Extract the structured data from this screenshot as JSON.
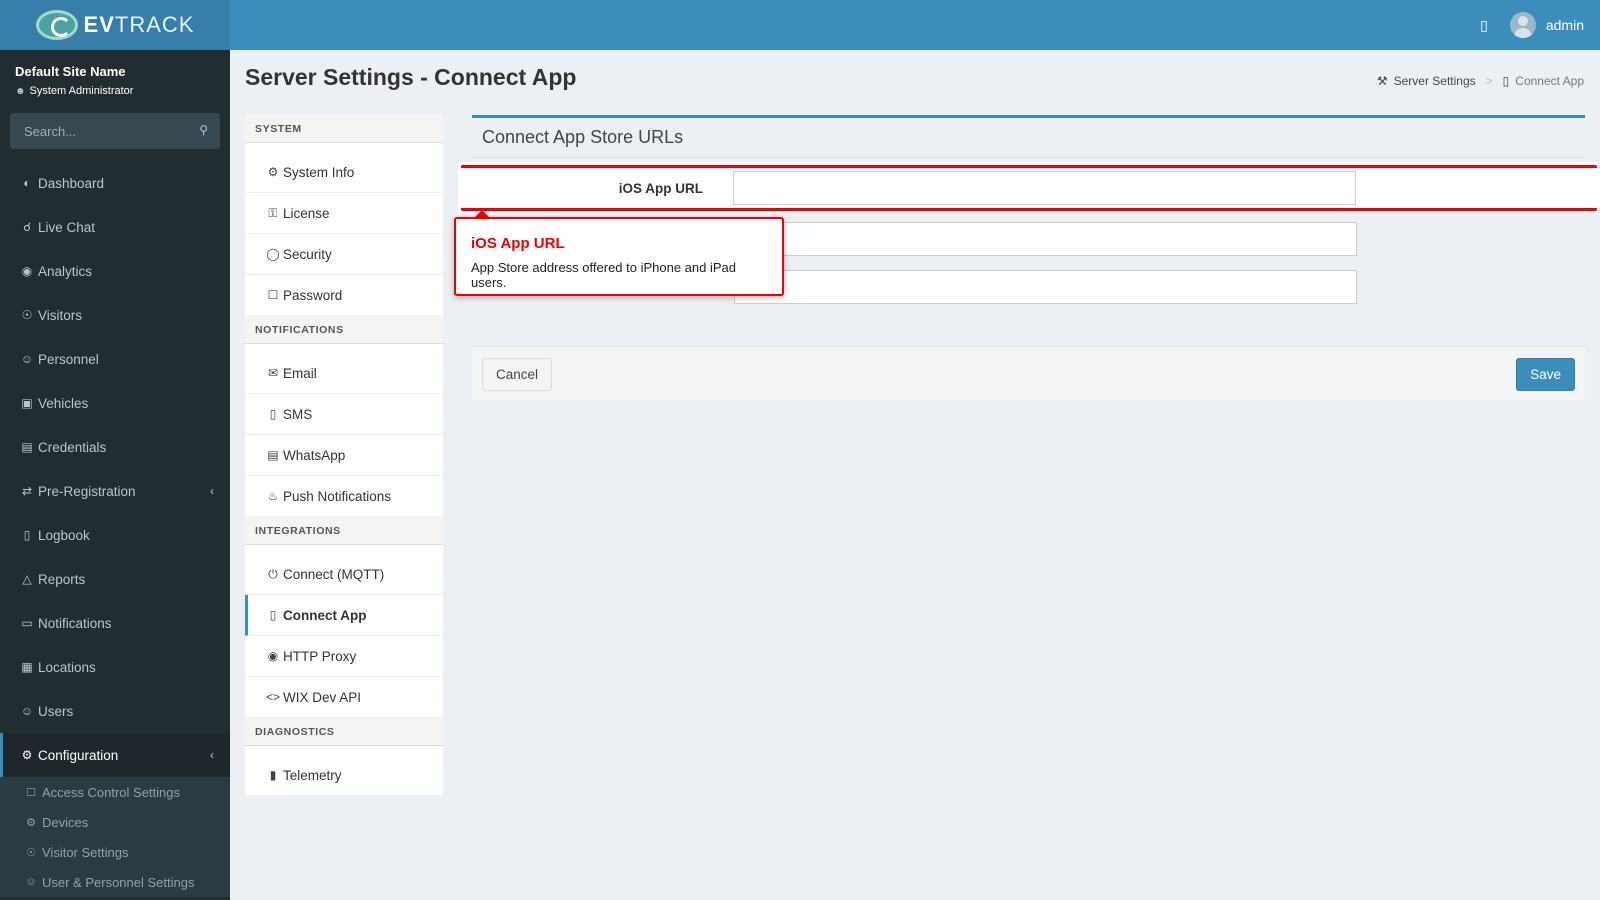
{
  "header": {
    "brand_prefix": "EV",
    "brand_suffix": "TRACK",
    "user_name": "admin",
    "building_icon": "building-icon"
  },
  "sidebar": {
    "site_name": "Default Site Name",
    "role": "System Administrator",
    "search_placeholder": "Search...",
    "items": [
      {
        "label": "Dashboard",
        "icon": "dashboard-icon"
      },
      {
        "label": "Live Chat",
        "icon": "headset-icon"
      },
      {
        "label": "Analytics",
        "icon": "analytics-icon"
      },
      {
        "label": "Visitors",
        "icon": "eye-icon"
      },
      {
        "label": "Personnel",
        "icon": "personnel-icon"
      },
      {
        "label": "Vehicles",
        "icon": "car-icon"
      },
      {
        "label": "Credentials",
        "icon": "credential-icon"
      },
      {
        "label": "Pre-Registration",
        "icon": "arrows-icon"
      },
      {
        "label": "Logbook",
        "icon": "book-icon"
      },
      {
        "label": "Reports",
        "icon": "chart-icon"
      },
      {
        "label": "Notifications",
        "icon": "notification-icon"
      },
      {
        "label": "Locations",
        "icon": "map-icon"
      },
      {
        "label": "Users",
        "icon": "users-icon"
      },
      {
        "label": "Configuration",
        "icon": "gear-icon"
      }
    ],
    "sub_items": [
      {
        "label": "Access Control Settings",
        "icon": "lock-icon"
      },
      {
        "label": "Devices",
        "icon": "devices-icon"
      },
      {
        "label": "Visitor Settings",
        "icon": "eye-icon"
      },
      {
        "label": "User & Personnel Settings",
        "icon": "users-icon"
      }
    ]
  },
  "page": {
    "title": "Server Settings - Connect App",
    "breadcrumb_parent": "Server Settings",
    "breadcrumb_current": "Connect App"
  },
  "settings_menu": {
    "system_header": "SYSTEM",
    "system": [
      {
        "label": "System Info",
        "icon": "gear-icon"
      },
      {
        "label": "License",
        "icon": "key-icon"
      },
      {
        "label": "Security",
        "icon": "shield-icon"
      },
      {
        "label": "Password",
        "icon": "lock-icon"
      }
    ],
    "notifications_header": "NOTIFICATIONS",
    "notifications": [
      {
        "label": "Email",
        "icon": "envelope-icon"
      },
      {
        "label": "SMS",
        "icon": "mobile-icon"
      },
      {
        "label": "WhatsApp",
        "icon": "message-icon"
      },
      {
        "label": "Push Notifications",
        "icon": "bell-icon"
      }
    ],
    "integrations_header": "INTEGRATIONS",
    "integrations": [
      {
        "label": "Connect (MQTT)",
        "icon": "plug-icon"
      },
      {
        "label": "Connect App",
        "icon": "mobile-icon"
      },
      {
        "label": "HTTP Proxy",
        "icon": "globe-icon"
      },
      {
        "label": "WIX Dev API",
        "icon": "code-icon"
      }
    ],
    "diagnostics_header": "DIAGNOSTICS",
    "diagnostics": [
      {
        "label": "Telemetry",
        "icon": "bar-chart-icon"
      }
    ]
  },
  "form": {
    "box_title": "Connect App Store URLs",
    "ios_label": "iOS App URL",
    "ios_value": "",
    "android_value": "",
    "third_value": "",
    "cancel_label": "Cancel",
    "save_label": "Save"
  },
  "tooltip": {
    "title": "iOS App URL",
    "body": "App Store address offered to iPhone and iPad users."
  },
  "colors": {
    "primary": "#3c8dbc",
    "sidebar_bg": "#222d32",
    "highlight": "#ee0000"
  }
}
